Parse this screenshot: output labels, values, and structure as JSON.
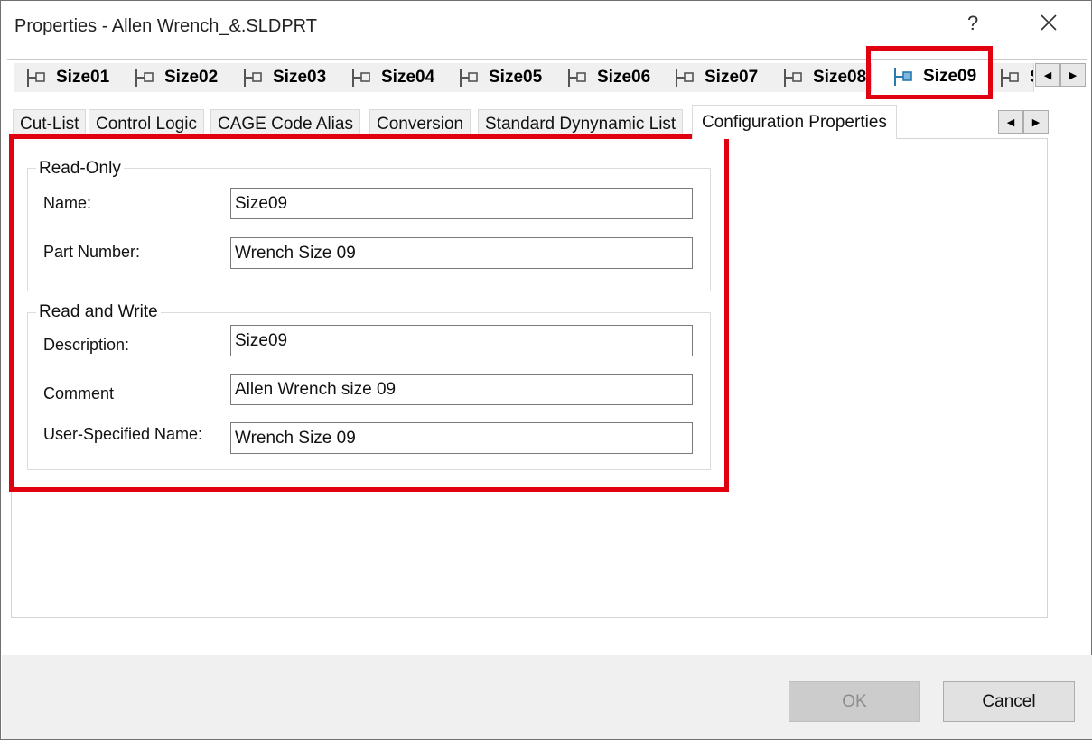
{
  "window": {
    "title": "Properties - Allen Wrench_&.SLDPRT",
    "help_label": "?",
    "close_label": "✕"
  },
  "config_tabs": {
    "items": [
      {
        "label": "Size01"
      },
      {
        "label": "Size02"
      },
      {
        "label": "Size03"
      },
      {
        "label": "Size04"
      },
      {
        "label": "Size05"
      },
      {
        "label": "Size06"
      },
      {
        "label": "Size07"
      },
      {
        "label": "Size08"
      },
      {
        "label": "Size09"
      },
      {
        "label": "S"
      }
    ],
    "active": "Size09",
    "scroll_left": "◀",
    "scroll_right": "▶"
  },
  "property_tabs": {
    "items": [
      {
        "label": "Cut-List"
      },
      {
        "label": "Control Logic"
      },
      {
        "label": "CAGE Code Alias"
      },
      {
        "label": "Conversion"
      },
      {
        "label": "Standard Dynynamic List"
      },
      {
        "label": "Configuration Properties"
      }
    ],
    "active": "Configuration Properties",
    "scroll_left": "◀",
    "scroll_right": "▶"
  },
  "read_only": {
    "legend": "Read-Only",
    "name_label": "Name:",
    "name_value": "Size09",
    "part_number_label": "Part Number:",
    "part_number_value": "Wrench Size 09"
  },
  "read_write": {
    "legend": "Read and Write",
    "description_label": "Description:",
    "description_value": "Size09",
    "comment_label": "Comment",
    "comment_value": "Allen Wrench size 09",
    "user_name_label": "User-Specified Name:",
    "user_name_value": "Wrench Size 09"
  },
  "footer": {
    "ok_label": "OK",
    "cancel_label": "Cancel"
  },
  "colors": {
    "highlight": "#e0000f",
    "active_icon": "#2a7ab0"
  }
}
